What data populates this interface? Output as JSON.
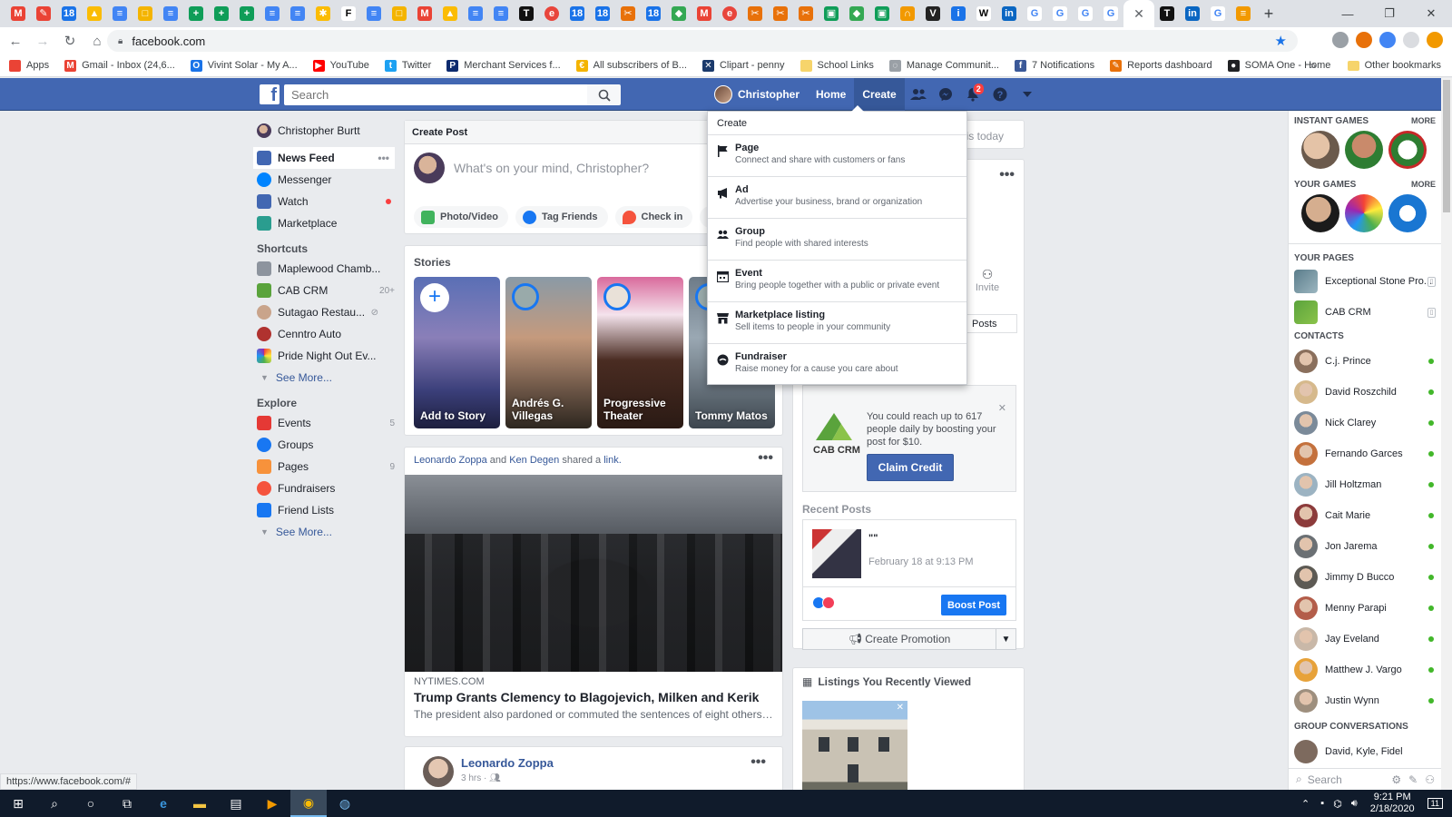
{
  "browser": {
    "url": "facebook.com",
    "bookmarks": [
      {
        "label": "Apps",
        "color": "#ea4335",
        "glyph": ""
      },
      {
        "label": "Gmail - Inbox (24,6...",
        "color": "#ea4335",
        "glyph": "M"
      },
      {
        "label": "Vivint Solar - My A...",
        "color": "#1a73e8",
        "glyph": "O"
      },
      {
        "label": "YouTube",
        "color": "#ff0000",
        "glyph": "▶"
      },
      {
        "label": "Twitter",
        "color": "#1da1f2",
        "glyph": "t"
      },
      {
        "label": "Merchant Services f...",
        "color": "#0d2a6e",
        "glyph": "P"
      },
      {
        "label": "All subscribers of B...",
        "color": "#f4b400",
        "glyph": "€"
      },
      {
        "label": "Clipart - penny",
        "color": "#1b3a6b",
        "glyph": "✕"
      },
      {
        "label": "School Links",
        "color": "#f6d46b",
        "glyph": ""
      },
      {
        "label": "Manage Communit...",
        "color": "#9aa0a6",
        "glyph": "◌"
      },
      {
        "label": "7 Notifications",
        "color": "#3b5998",
        "glyph": "f"
      },
      {
        "label": "Reports dashboard",
        "color": "#e8710a",
        "glyph": "✎"
      },
      {
        "label": "SOMA One - Home",
        "color": "#202124",
        "glyph": "●"
      }
    ],
    "other_bookmarks": "Other bookmarks",
    "status_url": "https://www.facebook.com/#"
  },
  "fb": {
    "search_placeholder": "Search",
    "user_name": "Christopher",
    "nav_home": "Home",
    "nav_create": "Create",
    "notif_count": "2",
    "brand_color": "#4267b2"
  },
  "left_nav": {
    "profile": "Christopher Burtt",
    "main": [
      {
        "label": "News Feed",
        "color": "#4267b2"
      },
      {
        "label": "Messenger",
        "color": "#0084ff"
      },
      {
        "label": "Watch",
        "color": "#4267b2"
      },
      {
        "label": "Marketplace",
        "color": "#2a9d8f"
      }
    ],
    "shortcuts_title": "Shortcuts",
    "shortcuts": [
      {
        "label": "Maplewood Chamb...",
        "count": ""
      },
      {
        "label": "CAB CRM",
        "count": "20+"
      },
      {
        "label": "Sutagao Restau...",
        "count": ""
      },
      {
        "label": "Cenntro Auto",
        "count": ""
      },
      {
        "label": "Pride Night Out Ev...",
        "count": ""
      }
    ],
    "see_more": "See More...",
    "explore_title": "Explore",
    "explore": [
      {
        "label": "Events",
        "count": "5"
      },
      {
        "label": "Groups",
        "count": ""
      },
      {
        "label": "Pages",
        "count": "9"
      },
      {
        "label": "Fundraisers",
        "count": ""
      },
      {
        "label": "Friend Lists",
        "count": ""
      }
    ],
    "see_more_2": "See More..."
  },
  "create_post": {
    "title": "Create Post",
    "placeholder": "What's on your mind, Christopher?",
    "actions": [
      "Photo/Video",
      "Tag Friends",
      "Check in",
      "•••"
    ]
  },
  "stories": {
    "title": "Stories",
    "items": [
      {
        "label": "Add to Story"
      },
      {
        "label": "Andrés G. Villegas"
      },
      {
        "label": "Progressive Theater"
      },
      {
        "label": "Tommy Matos"
      }
    ]
  },
  "post": {
    "author1": "Leonardo Zoppa",
    "and": "and",
    "author2": "Ken Degen",
    "shared": "shared a",
    "link": "link.",
    "source": "NYTIMES.COM",
    "title": "Trump Grants Clemency to Blagojevich, Milken and Kerik",
    "desc": "The president also pardoned or commuted the sentences of eight others o..."
  },
  "post2": {
    "author": "Leonardo Zoppa",
    "time": "3 hrs"
  },
  "right_col": {
    "top_text": "is today",
    "invite": "Invite",
    "posts_tab": "Posts",
    "promo_text": "You could reach up to 617 people daily by boosting your post for $10.",
    "claim": "Claim Credit",
    "recent_title": "Recent Posts",
    "recent_text": "\"\"",
    "recent_date": "February 18 at 9:13 PM",
    "boost": "Boost Post",
    "create_promotion": "Create Promotion",
    "listings_title": "Listings You Recently Viewed"
  },
  "create_menu": {
    "title": "Create",
    "items": [
      {
        "label": "Page",
        "desc": "Connect and share with customers or fans"
      },
      {
        "label": "Ad",
        "desc": "Advertise your business, brand or organization"
      },
      {
        "label": "Group",
        "desc": "Find people with shared interests"
      },
      {
        "label": "Event",
        "desc": "Bring people together with a public or private event"
      },
      {
        "label": "Marketplace listing",
        "desc": "Sell items to people in your community"
      },
      {
        "label": "Fundraiser",
        "desc": "Raise money for a cause you care about"
      }
    ]
  },
  "chat": {
    "instant_games": "INSTANT GAMES",
    "your_games": "YOUR GAMES",
    "more": "MORE",
    "your_pages": "YOUR PAGES",
    "pages": [
      {
        "label": "Exceptional Stone Pro..."
      },
      {
        "label": "CAB CRM"
      }
    ],
    "contacts_title": "CONTACTS",
    "contacts": [
      {
        "name": "C.j. Prince",
        "color": "#8a6f5c"
      },
      {
        "name": "David Roszchild",
        "color": "#d6b98c"
      },
      {
        "name": "Nick Clarey",
        "color": "#7b8a99"
      },
      {
        "name": "Fernando Garces",
        "color": "#c4713d"
      },
      {
        "name": "Jill Holtzman",
        "color": "#9cb3c2"
      },
      {
        "name": "Cait Marie",
        "color": "#8c3b3b"
      },
      {
        "name": "Jon Jarema",
        "color": "#6b7074"
      },
      {
        "name": "Jimmy D Bucco",
        "color": "#5d5a54"
      },
      {
        "name": "Menny Parapi",
        "color": "#b35d4a"
      },
      {
        "name": "Jay Eveland",
        "color": "#c9b8a8"
      },
      {
        "name": "Matthew J. Vargo",
        "color": "#e7a23a"
      },
      {
        "name": "Justin Wynn",
        "color": "#9e8f7e"
      }
    ],
    "group_conv": "GROUP CONVERSATIONS",
    "group_item": "David, Kyle, Fidel",
    "search": "Search"
  },
  "taskbar": {
    "time": "9:21 PM",
    "date": "2/18/2020",
    "notif": "11"
  }
}
